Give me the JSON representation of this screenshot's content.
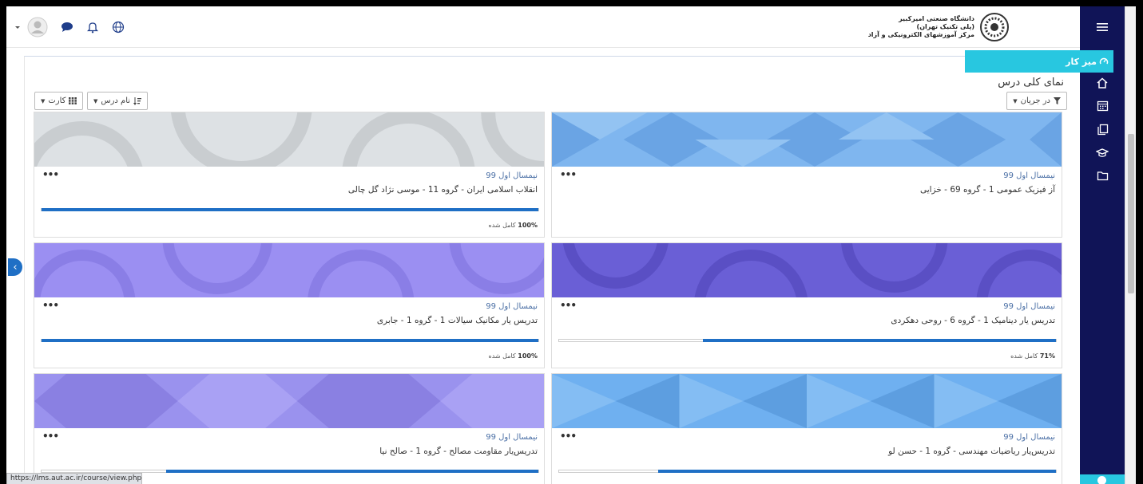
{
  "header": {
    "logo_line1": "دانشگاه صنعتی امیرکبیر",
    "logo_line2": "(پلی تکنیک تهران)",
    "logo_line3": "مرکز آموزشهای الکترونیکی و آزاد"
  },
  "drawer": {
    "dashboard_label": "میز کار",
    "icons": [
      "menu-icon",
      "home-icon",
      "calendar-icon",
      "files-icon",
      "graduation-cap-icon",
      "folder-icon"
    ]
  },
  "main": {
    "title": "نمای کلی درس",
    "filter_label": "در جریان",
    "sort_label": "نام درس",
    "view_label": "کارت"
  },
  "courses": [
    {
      "term": "نیمسال اول 99",
      "name": "آز فیزیک عمومی 1 - گروه 69 - خزایی",
      "progress": null,
      "progress_label": "",
      "image": "light-blue-diamonds"
    },
    {
      "term": "نیمسال اول 99",
      "name": "انقلاب اسلامی ایران - گروه 11 - موسی نژاد گل چالی",
      "progress": 100,
      "progress_label": "100%",
      "image": "grey-circles"
    },
    {
      "term": "نیمسال اول 99",
      "name": "تدریس یار دینامیک 1 - گروه 6 - روحی دهکردی",
      "progress": 71,
      "progress_label": "71%",
      "image": "indigo-circles"
    },
    {
      "term": "نیمسال اول 99",
      "name": "تدریس یار مکانیک سیالات 1 - گروه 1 - جابری",
      "progress": 100,
      "progress_label": "100%",
      "image": "lavender-circles"
    },
    {
      "term": "نیمسال اول 99",
      "name": "تدریس‌یار ریاضیات مهندسی - گروه 1 - حسن لو",
      "progress": 80,
      "progress_label": "",
      "image": "sky-triangles"
    },
    {
      "term": "نیمسال اول 99",
      "name": "تدریس‌یار مقاومت مصالح - گروه 1 - صالح نیا",
      "progress": 75,
      "progress_label": "",
      "image": "purple-hexagons"
    }
  ],
  "complete_suffix": "کامل شده",
  "status_bar": {
    "url": "https://lms.aut.ac.ir/course/view.php"
  }
}
